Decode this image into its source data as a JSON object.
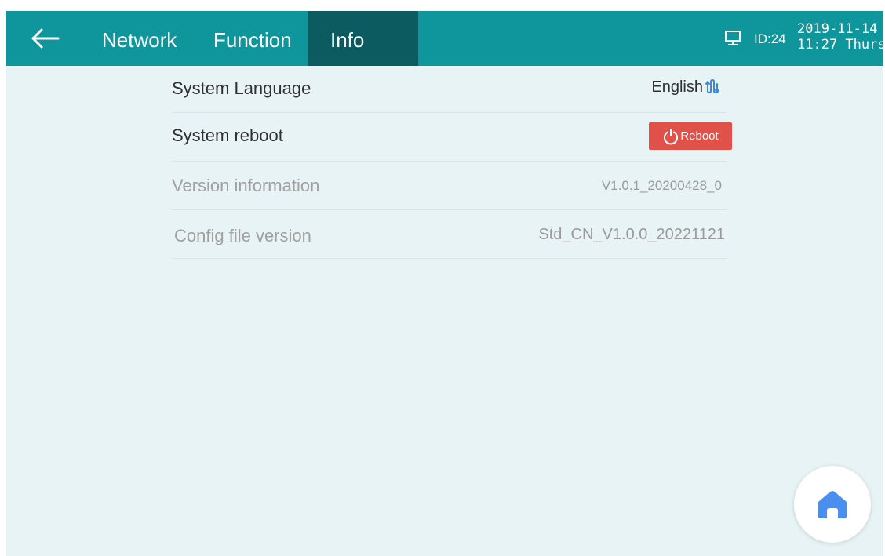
{
  "header": {
    "back_icon": "arrow-left-icon",
    "tabs": [
      {
        "label": "Network",
        "active": false
      },
      {
        "label": "Function",
        "active": false
      },
      {
        "label": "Info",
        "active": true
      }
    ],
    "status_icon": "monitor-icon",
    "device_id": "ID:24",
    "date": "2019-11-14",
    "time_day": "11:27 Thurs"
  },
  "settings": {
    "language": {
      "label": "System Language",
      "value": "English",
      "icon": "switch-icon"
    },
    "reboot": {
      "label": "System reboot",
      "button_label": "Reboot",
      "button_icon": "power-icon"
    },
    "version": {
      "label": "Version information",
      "value": "V1.0.1_20200428_0"
    },
    "config": {
      "label": "Config file version",
      "value": "Std_CN_V1.0.0_20221121"
    }
  },
  "home_button": {
    "icon": "home-icon"
  },
  "colors": {
    "header_bg": "#0f969c",
    "active_tab_bg": "#0c5b61",
    "content_bg": "#e8f3f5",
    "reboot_bg": "#e0514a",
    "home_icon": "#4a8ff0"
  }
}
